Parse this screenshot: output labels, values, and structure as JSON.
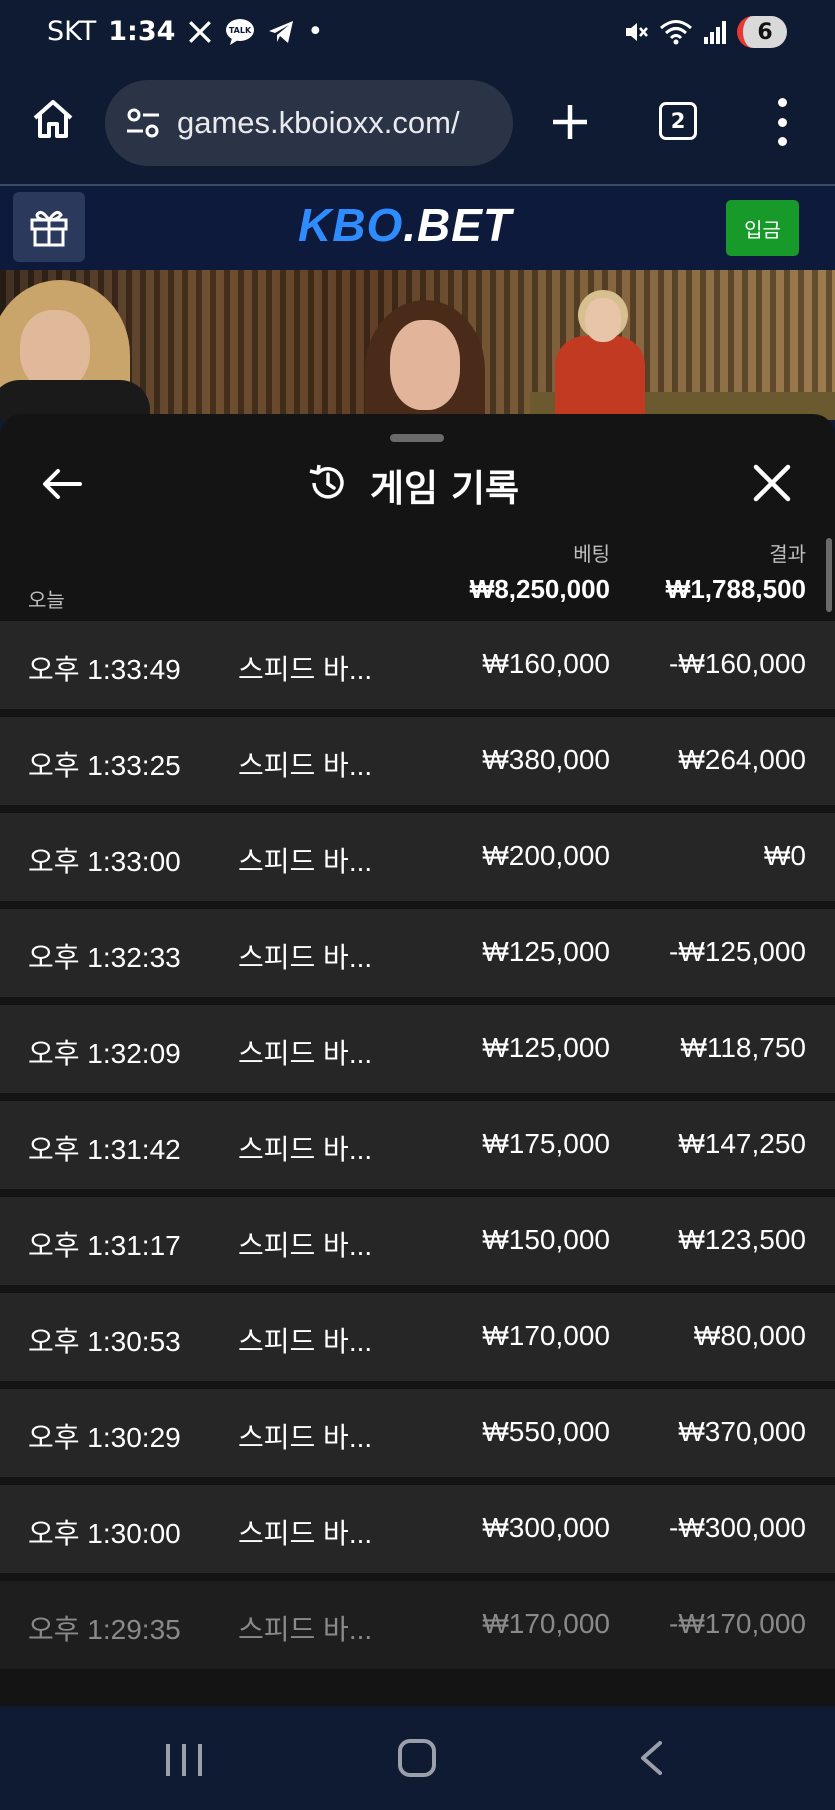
{
  "status_bar": {
    "carrier": "SKT",
    "time": "1:34",
    "notification_dot": "•",
    "battery_level": "6",
    "icons": [
      "x-icon",
      "kakaotalk-icon",
      "telegram-icon",
      "mute-icon",
      "wifi-icon",
      "signal-icon",
      "battery-icon"
    ]
  },
  "browser": {
    "url": "games.kboioxx.com/",
    "tab_count": "2",
    "icons": [
      "home-icon",
      "site-settings-icon",
      "new-tab-icon",
      "tabs-icon",
      "more-menu-icon"
    ]
  },
  "site": {
    "logo_part1": "KBO",
    "logo_part2": ".BET",
    "deposit_label": "입금",
    "colors": {
      "logo_blue": "#2f8cff",
      "deposit_green": "#179a2a",
      "header_bg": "#0d1a3c"
    }
  },
  "history": {
    "title": "게임 기록",
    "bet_header": "베팅",
    "result_header": "결과",
    "today_label": "오늘",
    "total_bet": "₩8,250,000",
    "total_result": "₩1,788,500",
    "rows": [
      {
        "time": "오후 1:33:49",
        "game": "스피드 바...",
        "bet": "₩160,000",
        "result": "-₩160,000"
      },
      {
        "time": "오후 1:33:25",
        "game": "스피드 바...",
        "bet": "₩380,000",
        "result": "₩264,000"
      },
      {
        "time": "오후 1:33:00",
        "game": "스피드 바...",
        "bet": "₩200,000",
        "result": "₩0"
      },
      {
        "time": "오후 1:32:33",
        "game": "스피드 바...",
        "bet": "₩125,000",
        "result": "-₩125,000"
      },
      {
        "time": "오후 1:32:09",
        "game": "스피드 바...",
        "bet": "₩125,000",
        "result": "₩118,750"
      },
      {
        "time": "오후 1:31:42",
        "game": "스피드 바...",
        "bet": "₩175,000",
        "result": "₩147,250"
      },
      {
        "time": "오후 1:31:17",
        "game": "스피드 바...",
        "bet": "₩150,000",
        "result": "₩123,500"
      },
      {
        "time": "오후 1:30:53",
        "game": "스피드 바...",
        "bet": "₩170,000",
        "result": "₩80,000"
      },
      {
        "time": "오후 1:30:29",
        "game": "스피드 바...",
        "bet": "₩550,000",
        "result": "₩370,000"
      },
      {
        "time": "오후 1:30:00",
        "game": "스피드 바...",
        "bet": "₩300,000",
        "result": "-₩300,000"
      },
      {
        "time": "오후 1:29:35",
        "game": "스피드 바...",
        "bet": "₩170,000",
        "result": "-₩170,000"
      }
    ]
  },
  "nav_bar": {
    "icons": [
      "recents-icon",
      "home-icon",
      "back-icon"
    ]
  }
}
